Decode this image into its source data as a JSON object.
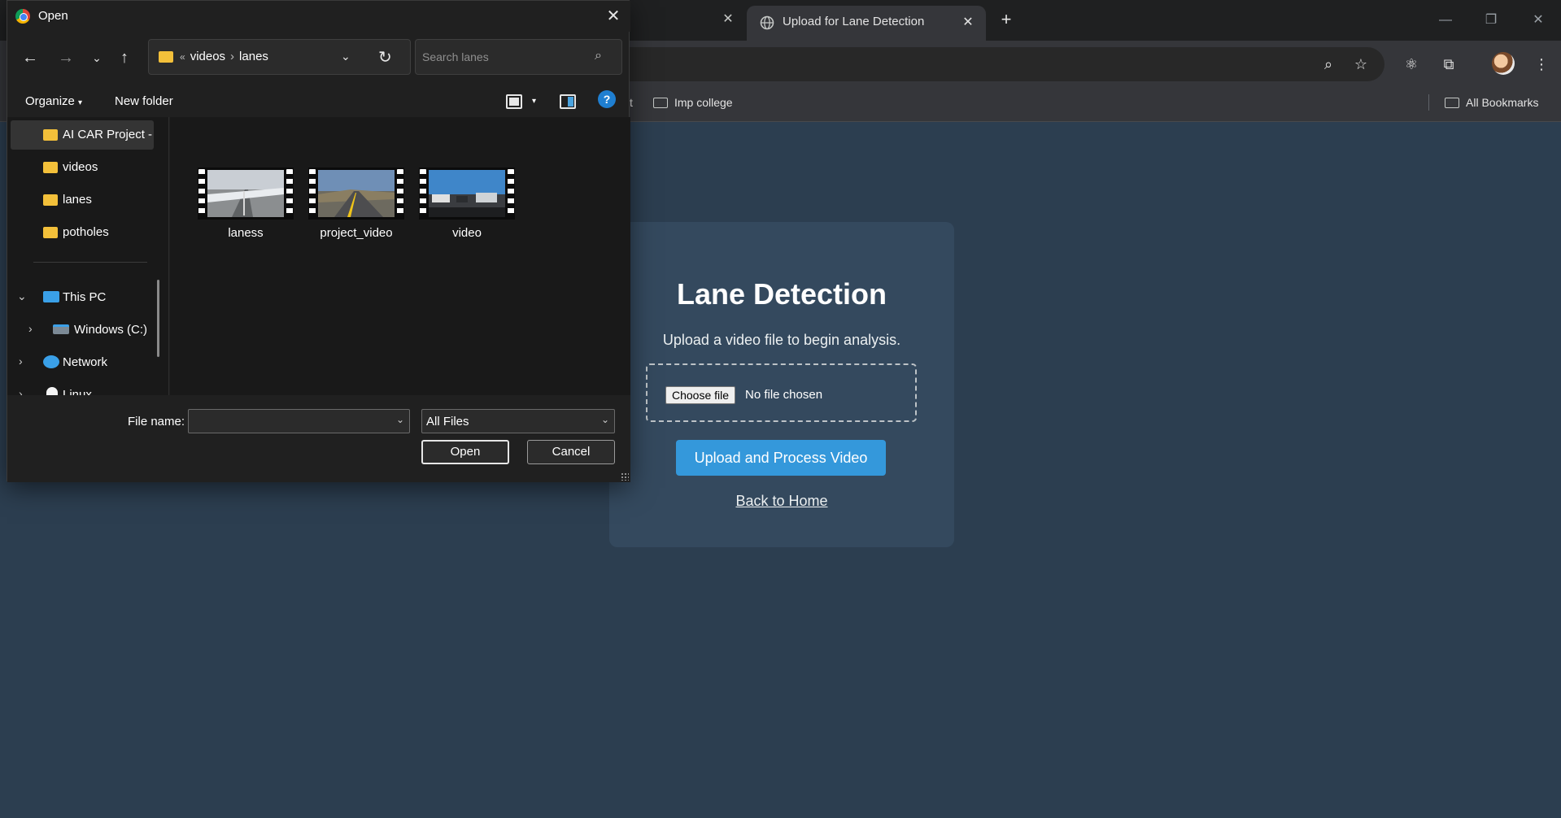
{
  "browser": {
    "active_tab_title": "Upload for Lane Detection",
    "bookmarks": [
      {
        "label": "t"
      },
      {
        "label": "Imp college"
      }
    ],
    "all_bookmarks_label": "All Bookmarks"
  },
  "page": {
    "title": "Lane Detection",
    "subtitle": "Upload a video file to begin analysis.",
    "choose_file_label": "Choose file",
    "no_file_text": "No file chosen",
    "upload_button": "Upload and Process Video",
    "back_link": "Back to Home",
    "colors": {
      "background": "#2c3e50",
      "card": "#34495e",
      "accent": "#3498db"
    }
  },
  "dialog": {
    "title": "Open",
    "breadcrumb_prefix": "«",
    "breadcrumb": [
      "videos",
      "lanes"
    ],
    "search_placeholder": "Search lanes",
    "organize_label": "Organize",
    "new_folder_label": "New folder",
    "help_glyph": "?",
    "nav_items": [
      {
        "label": "AI CAR Project -",
        "icon": "folder-icon",
        "selected": true
      },
      {
        "label": "videos",
        "icon": "folder-icon"
      },
      {
        "label": "lanes",
        "icon": "folder-icon"
      },
      {
        "label": "potholes",
        "icon": "folder-icon"
      },
      {
        "label": "This PC",
        "icon": "computer-icon",
        "expanded": true
      },
      {
        "label": "Windows (C:)",
        "icon": "drive-icon"
      },
      {
        "label": "Network",
        "icon": "network-icon"
      },
      {
        "label": "Linux",
        "icon": "linux-icon"
      }
    ],
    "files": [
      {
        "name": "laness",
        "icon": "video-file-icon"
      },
      {
        "name": "project_video",
        "icon": "video-file-icon"
      },
      {
        "name": "video",
        "icon": "video-file-icon"
      }
    ],
    "file_name_label": "File name:",
    "file_name_value": "",
    "file_type_value": "All Files",
    "open_button": "Open",
    "cancel_button": "Cancel"
  }
}
